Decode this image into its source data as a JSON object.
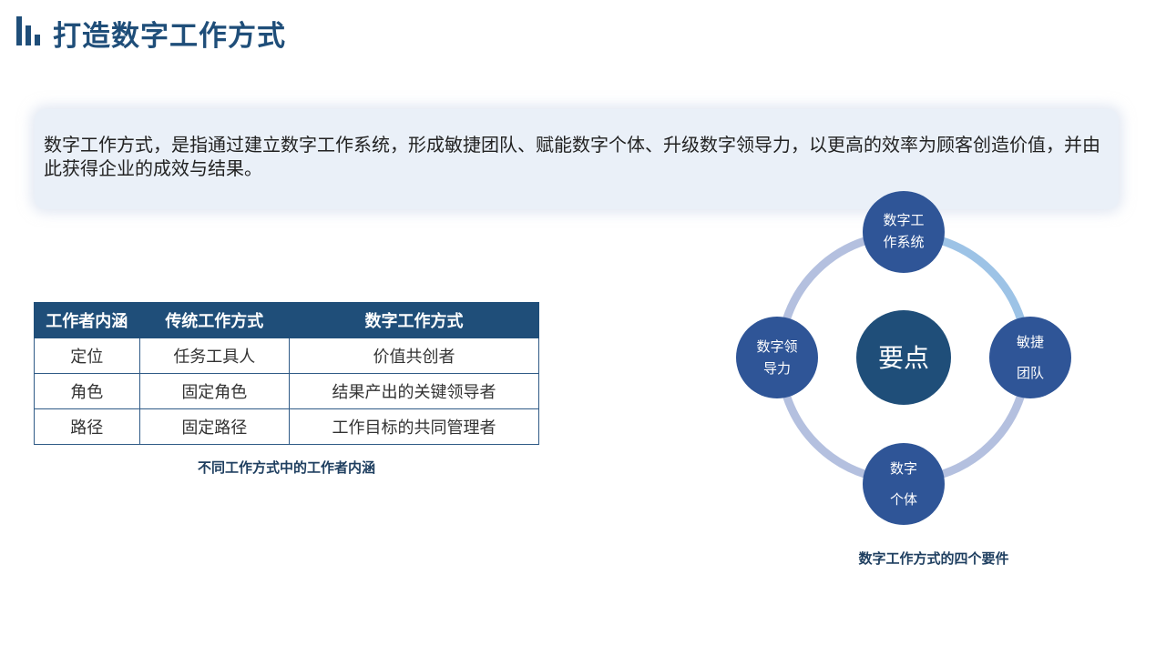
{
  "title": "打造数字工作方式",
  "intro": "数字工作方式，是指通过建立数字工作系统，形成敏捷团队、赋能数字个体、升级数字领导力，以更高的效率为顾客创造价值，并由此获得企业的成效与结果。",
  "table": {
    "headers": [
      "工作者内涵",
      "传统工作方式",
      "数字工作方式"
    ],
    "rows": [
      [
        "定位",
        "任务工具人",
        "价值共创者"
      ],
      [
        "角色",
        "固定角色",
        "结果产出的关键领导者"
      ],
      [
        "路径",
        "固定路径",
        "工作目标的共同管理者"
      ]
    ],
    "caption": "不同工作方式中的工作者内涵"
  },
  "diagram": {
    "center": "要点",
    "nodes": {
      "top": [
        "数字工",
        "作系统"
      ],
      "right": [
        "敏捷",
        "团队"
      ],
      "bottom": [
        "数字",
        "个体"
      ],
      "left": [
        "数字领",
        "导力"
      ]
    },
    "caption": "数字工作方式的四个要件"
  },
  "colors": {
    "title": "#1f4e79",
    "header_fill": "#1f4e79",
    "node_fill": "#2f5597",
    "center_fill": "#1f4e79",
    "ring_gray_blue": "#b4c0df",
    "ring_light_blue": "#9dc3e6",
    "intro_bg": "#eaf0f8"
  }
}
